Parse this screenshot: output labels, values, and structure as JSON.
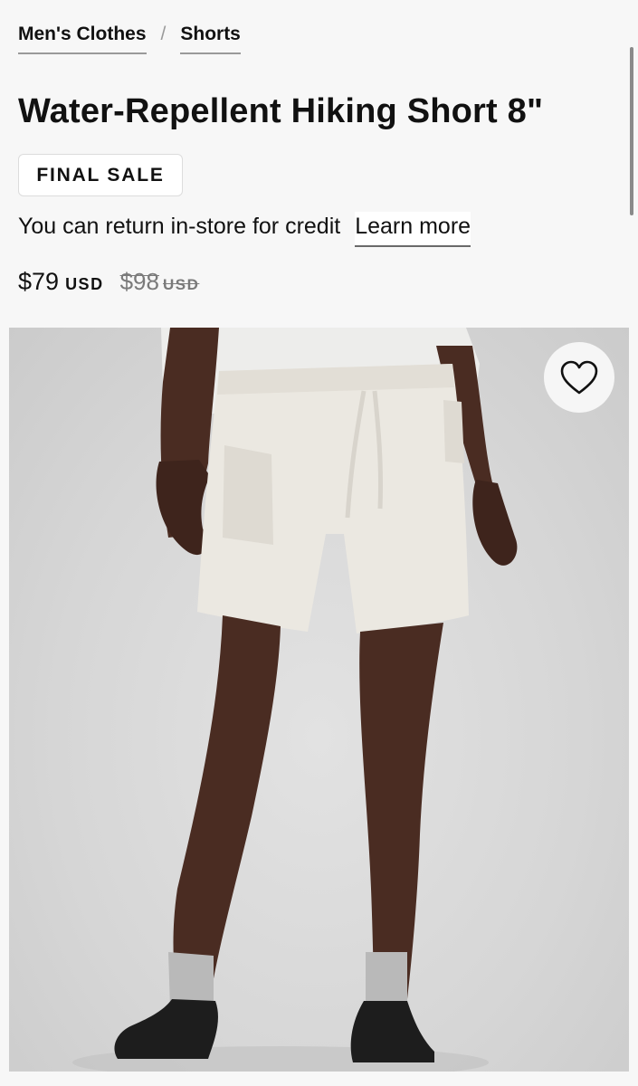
{
  "breadcrumb": {
    "items": [
      "Men's Clothes",
      "Shorts"
    ],
    "separator": "/"
  },
  "product": {
    "title": "Water-Repellent Hiking Short 8\"",
    "badge": "FINAL SALE",
    "return_note": "You can return in-store for credit",
    "learn_more": "Learn more",
    "price": {
      "current": "$79",
      "current_currency": "USD",
      "original": "$98",
      "original_currency": "USD"
    },
    "image": {
      "wishlist_icon": "heart-outline-icon"
    }
  },
  "colors": {
    "text": "#111111",
    "muted": "#7a7a7a",
    "shorts": "#ebe8e1",
    "skin": "#4a2c22",
    "sock": "#b9b9b9",
    "shoe": "#1d1d1d"
  }
}
